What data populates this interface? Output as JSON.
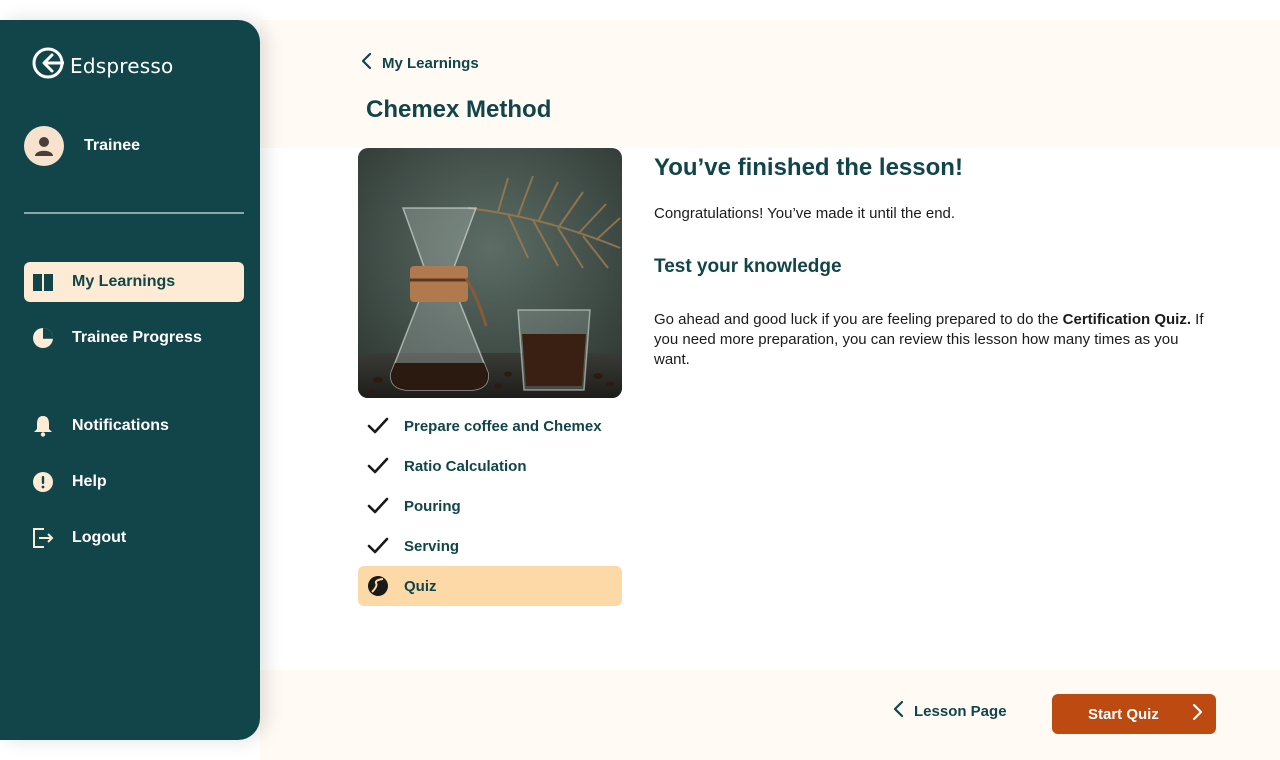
{
  "app": {
    "name": "Edspresso"
  },
  "user": {
    "name": "Trainee"
  },
  "sidebar": {
    "items": [
      {
        "label": "My Learnings",
        "icon": "book-icon",
        "active": true
      },
      {
        "label": "Trainee Progress",
        "icon": "pie-chart-icon",
        "active": false
      },
      {
        "label": "Notifications",
        "icon": "bell-icon",
        "active": false
      },
      {
        "label": "Help",
        "icon": "help-icon",
        "active": false
      },
      {
        "label": "Logout",
        "icon": "logout-icon",
        "active": false
      }
    ]
  },
  "header": {
    "back_label": "My Learnings",
    "title": "Chemex Method"
  },
  "lesson": {
    "steps": [
      {
        "label": "Prepare coffee and Chemex",
        "status": "done"
      },
      {
        "label": "Ratio Calculation",
        "status": "done"
      },
      {
        "label": "Pouring",
        "status": "done"
      },
      {
        "label": "Serving",
        "status": "done"
      },
      {
        "label": "Quiz",
        "status": "current"
      }
    ]
  },
  "content": {
    "finished_title": "You’ve finished the lesson!",
    "congrats_text": "Congratulations! You’ve made it until the end.",
    "test_title": "Test your knowledge",
    "go_text_before": "Go ahead and good luck if you are feeling prepared to do the ",
    "go_text_bold": "Certification Quiz.",
    "go_text_after": " If you need more preparation, you can review this lesson how many times as you want."
  },
  "footer": {
    "lesson_page_label": "Lesson Page",
    "start_quiz_label": "Start Quiz"
  },
  "colors": {
    "primary": "#11454a",
    "accent": "#bd4a11",
    "active_nav": "#fdebd5",
    "current_step": "#fdd9a8",
    "cream": "#fffaf3"
  }
}
